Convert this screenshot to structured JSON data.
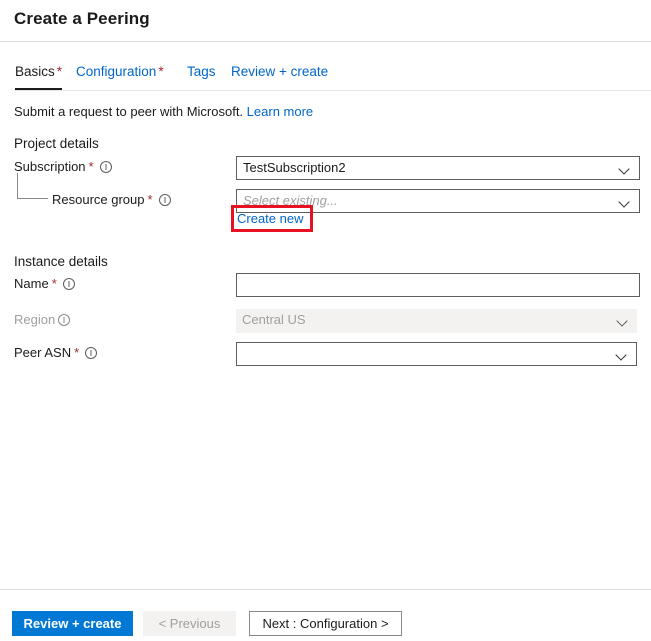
{
  "header": {
    "title": "Create a Peering"
  },
  "tabs": [
    {
      "id": "basics",
      "label": "Basics",
      "required_mark": "*",
      "active": true
    },
    {
      "id": "configuration",
      "label": "Configuration",
      "required_mark": "*",
      "active": false
    },
    {
      "id": "tags",
      "label": "Tags",
      "required_mark": "",
      "active": false
    },
    {
      "id": "review",
      "label": "Review + create",
      "required_mark": "",
      "active": false
    }
  ],
  "description": {
    "text": "Submit a request to peer with Microsoft.",
    "link_label": "Learn more"
  },
  "sections": {
    "project_details": {
      "heading": "Project details",
      "subscription": {
        "label": "Subscription",
        "required_mark": "*",
        "value": "TestSubscription2",
        "placeholder": ""
      },
      "resource_group": {
        "label": "Resource group",
        "required_mark": "*",
        "value": "",
        "placeholder": "Select existing...",
        "create_new_label": "Create new"
      }
    },
    "instance_details": {
      "heading": "Instance details",
      "name": {
        "label": "Name",
        "required_mark": "*",
        "value": "",
        "placeholder": ""
      },
      "region": {
        "label": "Region",
        "required_mark": "",
        "value": "Central US",
        "disabled": true
      },
      "peer_asn": {
        "label": "Peer ASN",
        "required_mark": "*",
        "value": "",
        "placeholder": ""
      }
    }
  },
  "footer": {
    "review_create_label": "Review + create",
    "previous_label": "< Previous",
    "next_label": "Next : Configuration >"
  },
  "annotation": {
    "highlight_color": "#e81123",
    "target": "Create new"
  },
  "colors": {
    "accent": "#0078d4",
    "link": "#0066cc",
    "required_asterisk": "#a4262c",
    "disabled_text": "#a19f9d",
    "disabled_field_bg": "#f3f2f1",
    "border": "#605e5c",
    "divider": "#dcdcdc"
  }
}
